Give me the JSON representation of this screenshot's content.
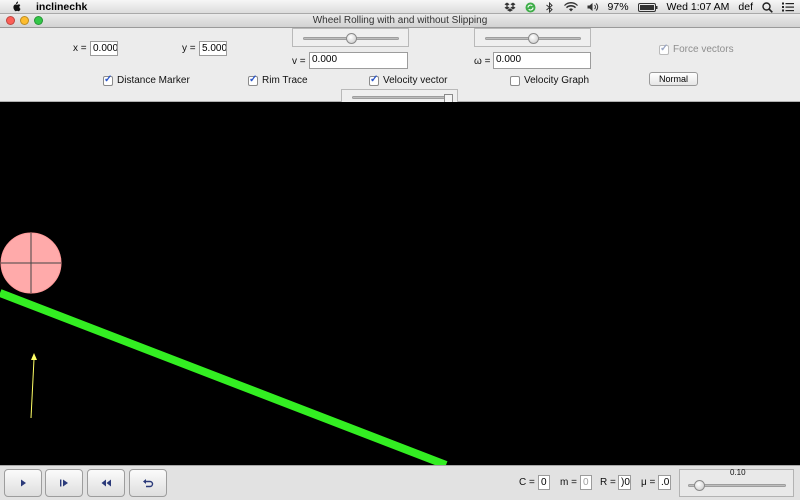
{
  "menubar": {
    "app_name": "inclinechk",
    "battery": "97%",
    "clock": "Wed 1:07 AM",
    "user": "def",
    "icons": [
      "apple-logo-icon",
      "dropbox-icon",
      "sync-icon",
      "bluetooth-icon",
      "wifi-icon",
      "volume-icon",
      "battery-icon",
      "spotlight-icon",
      "menu-list-icon"
    ]
  },
  "window": {
    "title": "Wheel Rolling with and without Slipping"
  },
  "controls": {
    "x_label": "x =",
    "x_value": "0.000",
    "y_label": "y =",
    "y_value": "5.000",
    "v_label": "v =",
    "v_value": "0.000",
    "omega_label": "ω =",
    "omega_value": "0.000",
    "force_vectors_label": "Force vectors",
    "force_vectors_checked": true,
    "force_vectors_enabled": false,
    "distance_marker_label": "Distance Marker",
    "distance_marker_checked": true,
    "rim_trace_label": "Rim Trace",
    "rim_trace_checked": true,
    "velocity_vector_label": "Velocity vector",
    "velocity_vector_checked": true,
    "velocity_graph_label": "Velocity Graph",
    "velocity_graph_checked": false,
    "mode_button_label": "Normal",
    "v_slider_level": 0.5,
    "omega_slider_level": 0.5
  },
  "scene": {
    "background": "#000000",
    "incline_color": "#33ee22",
    "wheel_color": "#ffaaaa",
    "vector_color": "#ffff66"
  },
  "bottom": {
    "c_label": "C =",
    "c_value": "0",
    "m_label": "m =",
    "m_value": "0",
    "r_label": "R =",
    "r_value": ")0",
    "mu_label": "μ =",
    "mu_value": ".0",
    "speed_value": "0.10",
    "speed_level": 0.1
  }
}
